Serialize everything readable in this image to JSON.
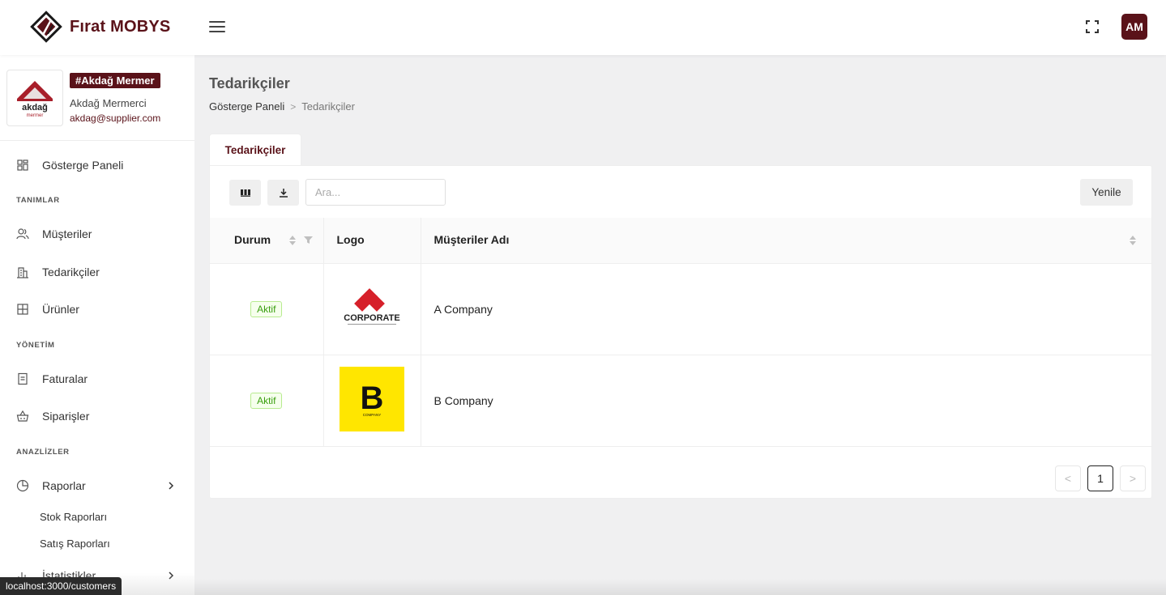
{
  "app": {
    "brand_name": "Fırat MOBYS",
    "avatar_initials": "AM",
    "accent_color": "#5a1219"
  },
  "profile": {
    "tag": "#Akdağ Mermer",
    "name": "Akdağ Mermerci",
    "email": "akdag@supplier.com",
    "logo_text_top": "akdağ",
    "logo_text_bottom": "mermer"
  },
  "sidebar": {
    "dashboard": "Gösterge Paneli",
    "section_definitions": "TANIMLAR",
    "customers": "Müşteriler",
    "suppliers": "Tedarikçiler",
    "products": "Ürünler",
    "section_management": "YÖNETİM",
    "invoices": "Faturalar",
    "orders": "Siparişler",
    "section_analyses": "ANAZLİZLER",
    "reports": "Raporlar",
    "stock_reports": "Stok Raporları",
    "sales_reports": "Satış Raporları",
    "statistics": "İstatistikler"
  },
  "page": {
    "title": "Tedarikçiler",
    "breadcrumb_home": "Gösterge Paneli",
    "breadcrumb_sep": ">",
    "breadcrumb_current": "Tedarikçiler",
    "tab_label": "Tedarikçiler"
  },
  "toolbar": {
    "search_placeholder": "Ara...",
    "refresh_label": "Yenile"
  },
  "table": {
    "headers": {
      "status": "Durum",
      "logo": "Logo",
      "name": "Müşteriler Adı"
    },
    "rows": [
      {
        "status": "Aktif",
        "logo_text": "CORPORATE",
        "logo_subtext": "",
        "name": "A Company"
      },
      {
        "status": "Aktif",
        "logo_text": "B",
        "logo_subtext": "COMPANY",
        "name": "B Company"
      }
    ]
  },
  "pagination": {
    "prev": "<",
    "current": "1",
    "next": ">"
  },
  "status_bar": {
    "url": "localhost:3000/customers"
  }
}
